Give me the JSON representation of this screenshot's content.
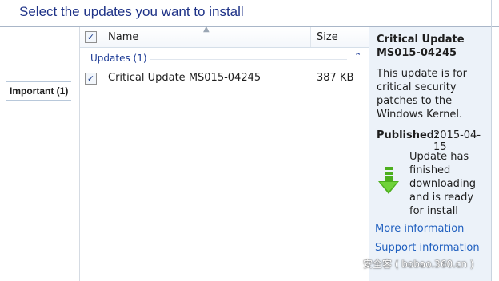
{
  "header": {
    "title": "Select the updates you want to install"
  },
  "categories": [
    {
      "label": "Important (1)"
    }
  ],
  "list": {
    "columns": {
      "name": "Name",
      "size": "Size"
    },
    "header_check": "✓",
    "group": {
      "label": "Updates (1)",
      "chevron": "^"
    },
    "rows": [
      {
        "check": "✓",
        "name": "Critical Update MS015-04245",
        "size": "387 KB"
      }
    ]
  },
  "details": {
    "title": "Critical Update MS015-04245",
    "description": "This update is for critical security patches to the Windows Kernel.",
    "published_label": "Published:",
    "published_value": "2015-04-15",
    "status": "Update has finished downloading and is ready for install",
    "status_icon": "download-arrow-icon",
    "more_info": "More information",
    "support_info": "Support information"
  },
  "watermark": "安全客 ( bobao.360.cn )",
  "colors": {
    "heading": "#1e3287",
    "link": "#1f5fbf",
    "details_bg": "#ecf2f9",
    "icon_green": "#4caf1e"
  }
}
